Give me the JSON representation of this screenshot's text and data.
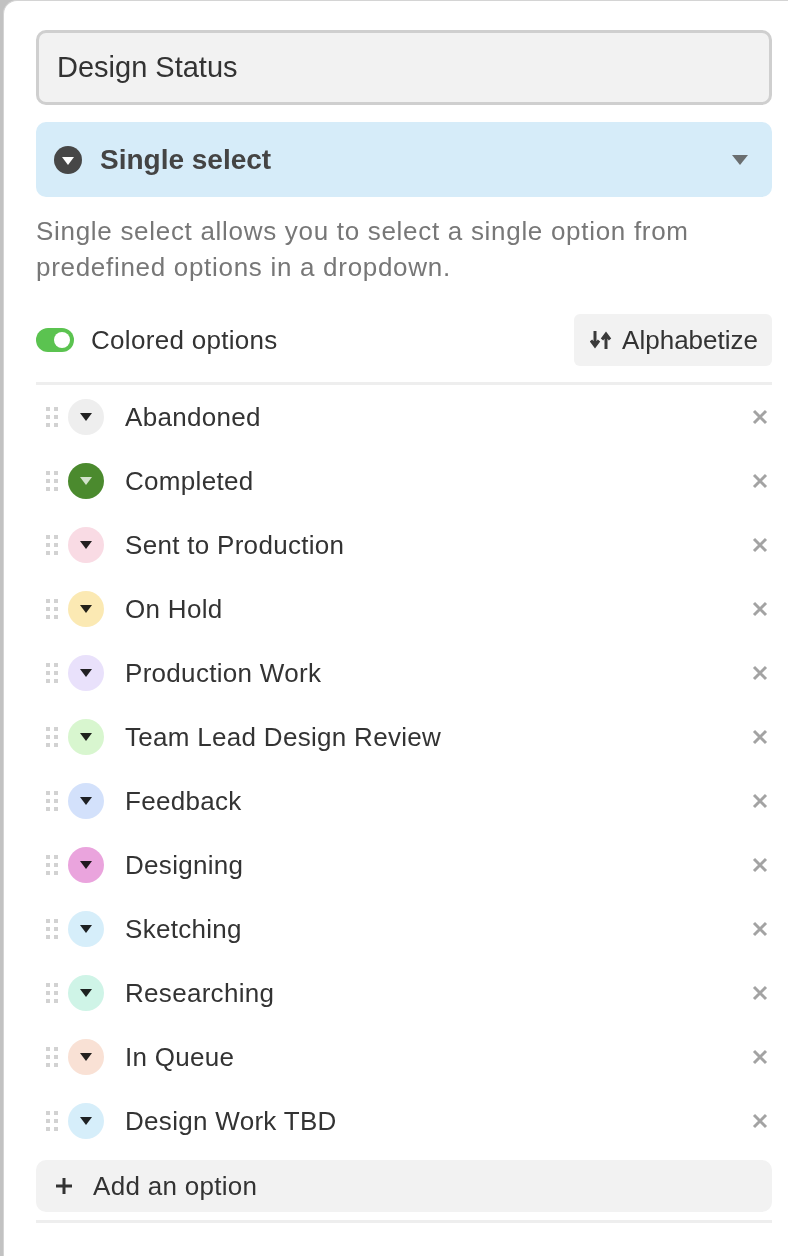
{
  "field_name": {
    "value": "Design Status"
  },
  "field_type": {
    "label": "Single select"
  },
  "description": "Single select allows you to select a single option from predefined options in a dropdown.",
  "colored_options": {
    "label": "Colored options",
    "on": true
  },
  "alphabetize_button": {
    "label": "Alphabetize"
  },
  "options": [
    {
      "label": "Abandoned",
      "color": "#eeeeee"
    },
    {
      "label": "Completed",
      "color": "#4b8a2e"
    },
    {
      "label": "Sent to Production",
      "color": "#f9dbe4"
    },
    {
      "label": "On Hold",
      "color": "#fbe9b3"
    },
    {
      "label": "Production Work",
      "color": "#e9e1fb"
    },
    {
      "label": "Team Lead Design Review",
      "color": "#d8f6cf"
    },
    {
      "label": "Feedback",
      "color": "#d3e1fb"
    },
    {
      "label": "Designing",
      "color": "#eaa4dd"
    },
    {
      "label": "Sketching",
      "color": "#d6eefa"
    },
    {
      "label": "Researching",
      "color": "#cff4e7"
    },
    {
      "label": "In Queue",
      "color": "#f9e1d5"
    },
    {
      "label": "Design Work TBD",
      "color": "#d6eefa"
    }
  ],
  "add_option_button": {
    "label": "Add an option"
  }
}
